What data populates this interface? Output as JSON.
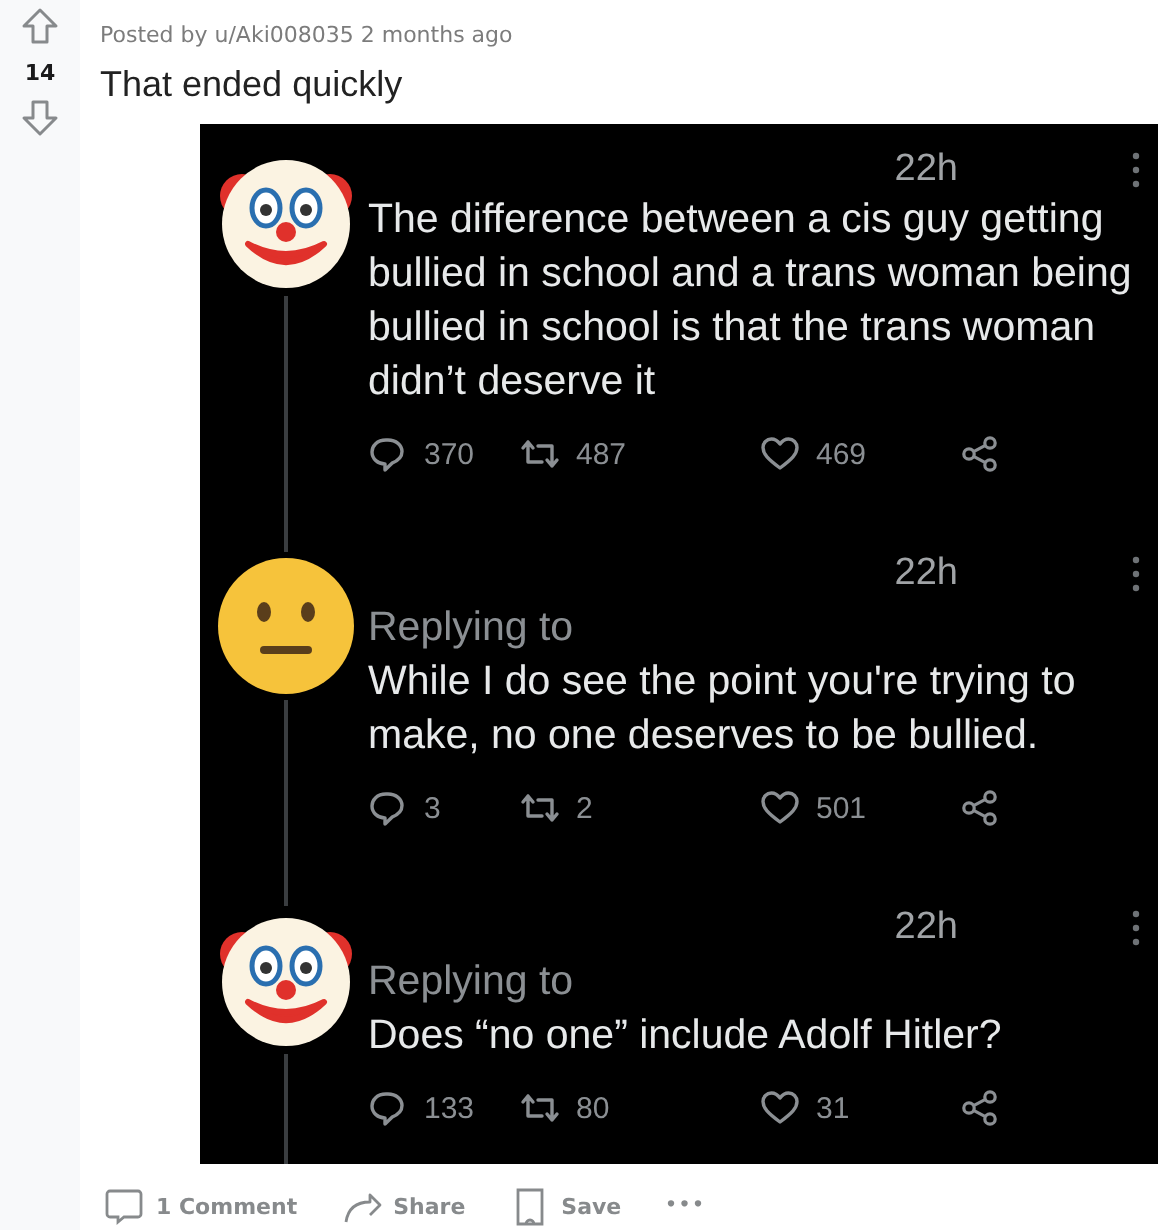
{
  "post": {
    "score": "14",
    "posted_by": "Posted by u/Aki008035 2 months ago",
    "title": "That ended quickly"
  },
  "image": {
    "tweets": [
      {
        "kind": "clown",
        "time": "22h",
        "text": "The difference between a cis guy getting bullied in school and a trans woman being bullied in school is that the trans woman didn’t deserve it",
        "replies": "370",
        "retweets": "487",
        "likes": "469"
      },
      {
        "kind": "neutral",
        "time": "22h",
        "replying_to": "Replying to",
        "text": "While I do see the point you're trying to make, no one deserves to be bullied.",
        "replies": "3",
        "retweets": "2",
        "likes": "501"
      },
      {
        "kind": "clown",
        "time": "22h",
        "replying_to": "Replying to",
        "text": "Does “no one” include Adolf Hitler?",
        "replies": "133",
        "retweets": "80",
        "likes": "31"
      }
    ]
  },
  "actions": [
    {
      "kind": "comment",
      "label": "1 Comment"
    },
    {
      "kind": "share",
      "label": "Share"
    },
    {
      "kind": "save",
      "label": "Save"
    },
    {
      "kind": "more",
      "label": "•••"
    }
  ]
}
